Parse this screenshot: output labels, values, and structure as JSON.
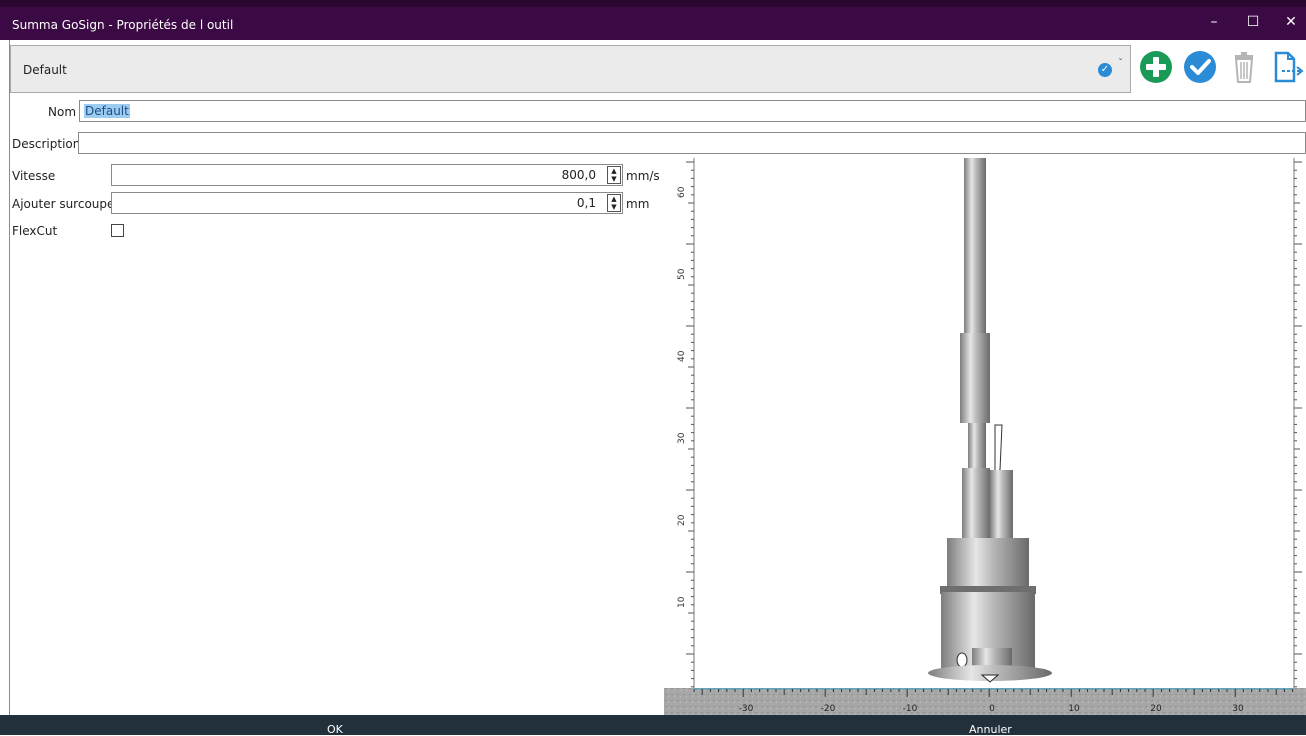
{
  "window": {
    "title": "Summa GoSign - Propriétés de l outil",
    "controls": {
      "minimize": "–",
      "maximize": "☐",
      "close": "✕"
    }
  },
  "toolbar": {
    "selected_preset": "Default",
    "icons": [
      "check-circle-icon",
      "add-icon",
      "confirm-icon",
      "trash-icon",
      "export-icon"
    ]
  },
  "form": {
    "name_label": "Nom",
    "name_value": "Default",
    "description_label": "Description",
    "description_value": "",
    "speed_label": "Vitesse",
    "speed_value": "800,0",
    "speed_unit": "mm/s",
    "overcut_label": "Ajouter surcoupe",
    "overcut_value": "0,1",
    "overcut_unit": "mm",
    "flexcut_label": "FlexCut",
    "flexcut_checked": false
  },
  "preview": {
    "y_ticks": [
      "60",
      "50",
      "40",
      "30",
      "20",
      "10"
    ],
    "x_ticks": [
      "-30",
      "-20",
      "-10",
      "0",
      "10",
      "20",
      "30"
    ]
  },
  "buttons": {
    "ok": "OK",
    "cancel": "Annuler"
  },
  "colors": {
    "titlebar": "#3b0a45",
    "accent_blue": "#2a8bd6",
    "accent_green": "#1a9a57",
    "footer": "#22303c"
  }
}
